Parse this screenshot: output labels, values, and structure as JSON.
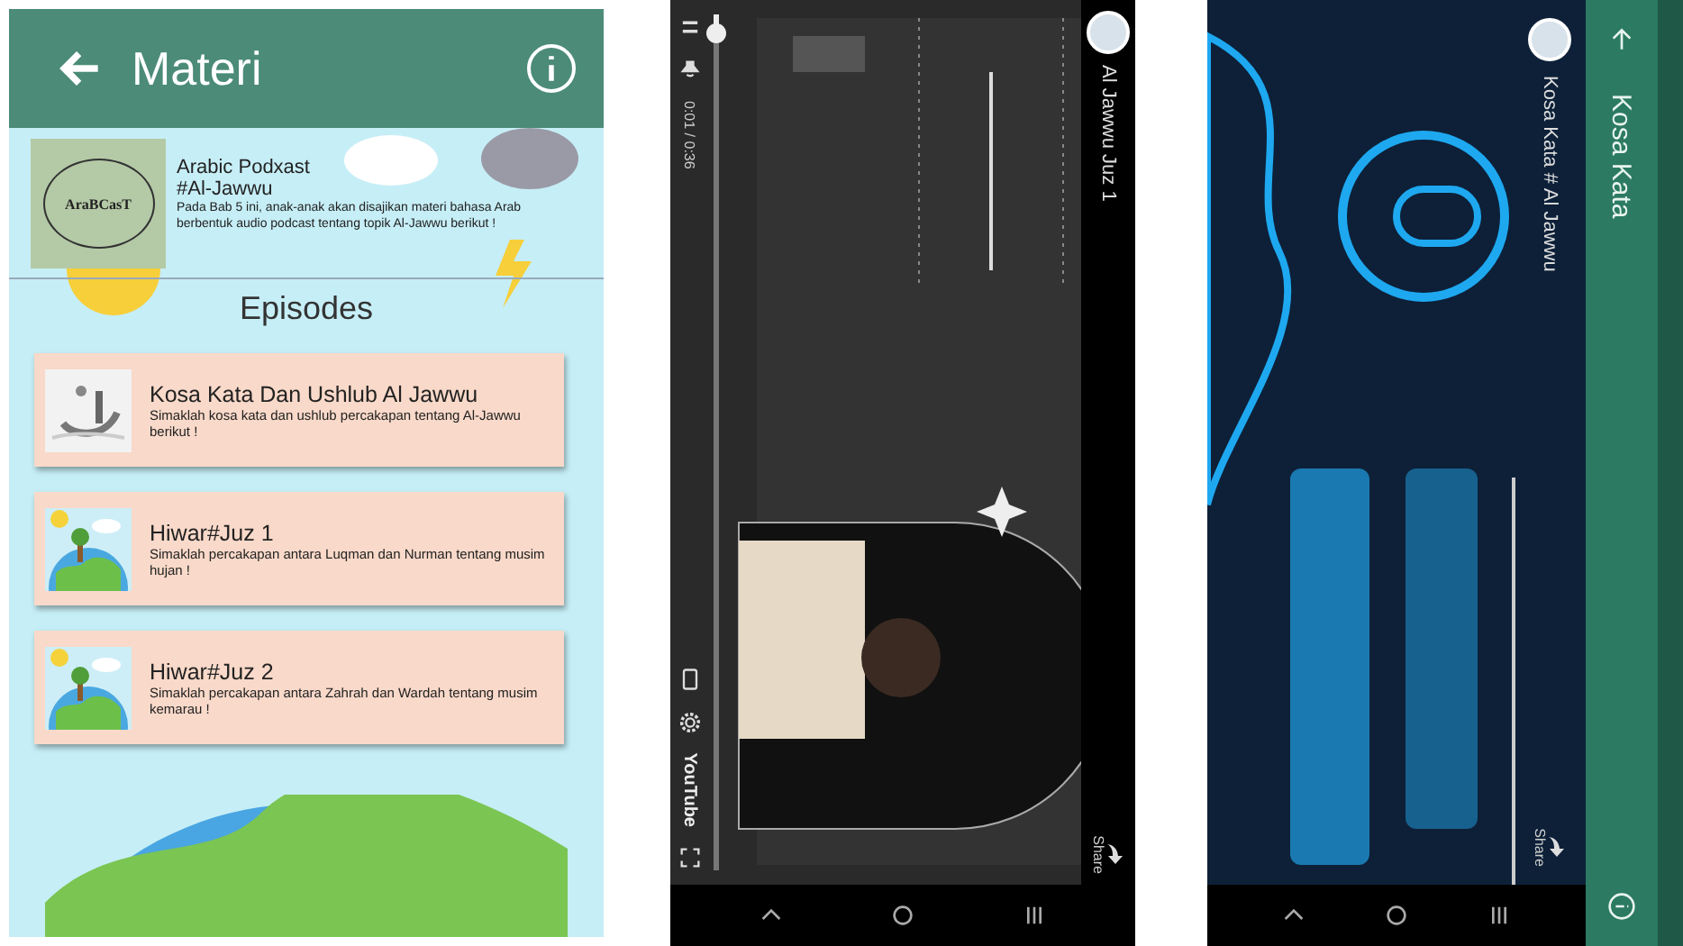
{
  "materi_screen": {
    "header": {
      "title": "Materi"
    },
    "intro": {
      "logo_text": "AraBCasT",
      "title": "Arabic Podxast #Al-Jawwu",
      "description": "Pada Bab 5 ini, anak-anak akan disajikan materi bahasa Arab berbentuk audio podcast tentang topik Al-Jawwu berikut !"
    },
    "section_title": "Episodes",
    "episodes": [
      {
        "kind": "calligraphy",
        "title": "Kosa Kata Dan Ushlub Al Jawwu",
        "description": "Simaklah kosa kata dan ushlub percakapan tentang Al-Jawwu berikut !"
      },
      {
        "kind": "earth",
        "title": "Hiwar#Juz 1",
        "description": "Simaklah percakapan antara Luqman dan Nurman tentang musim hujan !"
      },
      {
        "kind": "earth",
        "title": "Hiwar#Juz 2",
        "description": "Simaklah percakapan antara Zahrah dan Wardah tentang musim kemarau !"
      }
    ]
  },
  "video_screen": {
    "video_title": "Al Jawwu Juz 1",
    "share_label": "Share",
    "progress": {
      "level": 0.02
    },
    "time": "0:01 / 0:36",
    "brand": "YouTube"
  },
  "kosa_kata_screen": {
    "app_bar": {
      "title": "Kosa Kata"
    },
    "video_title": "Kosa Kata # Al Jawwu",
    "share_label": "Share"
  }
}
